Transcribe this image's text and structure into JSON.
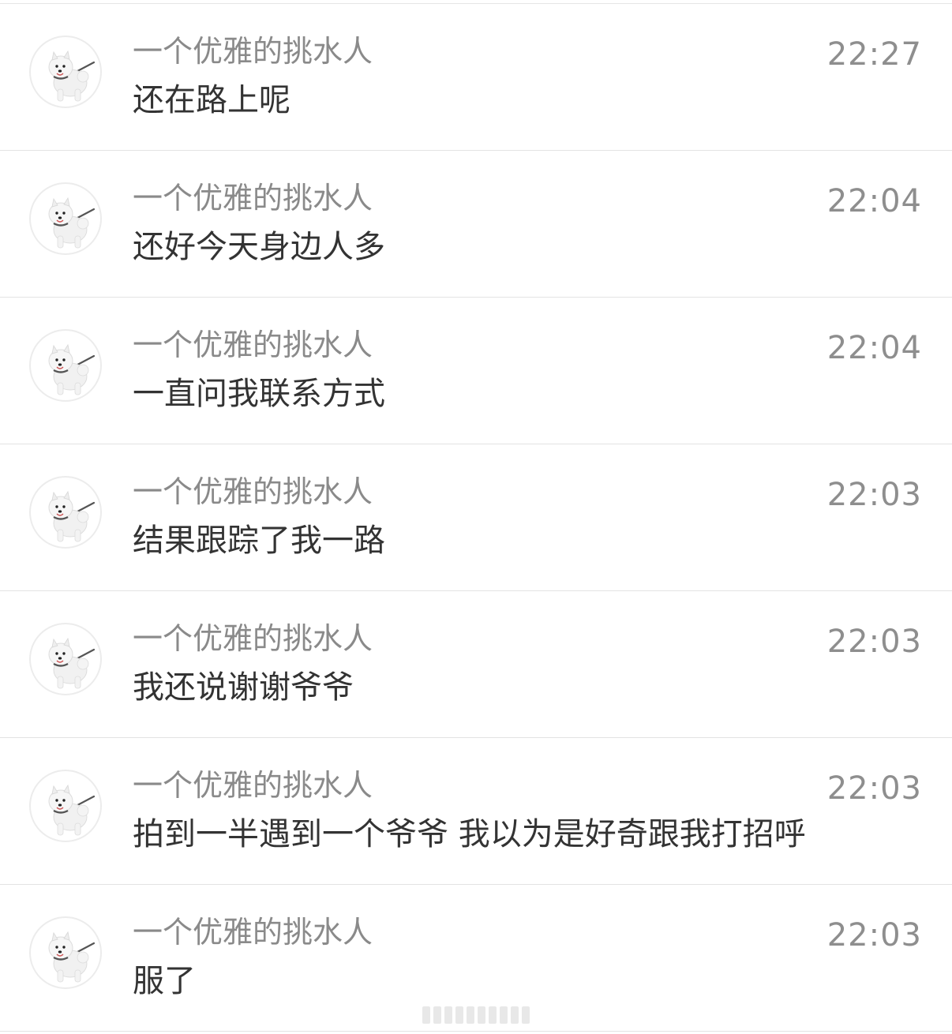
{
  "conversation": {
    "messages": [
      {
        "sender": "一个优雅的挑水人",
        "time": "22:27",
        "text": "还在路上呢"
      },
      {
        "sender": "一个优雅的挑水人",
        "time": "22:04",
        "text": "还好今天身边人多"
      },
      {
        "sender": "一个优雅的挑水人",
        "time": "22:04",
        "text": "一直问我联系方式"
      },
      {
        "sender": "一个优雅的挑水人",
        "time": "22:03",
        "text": "结果跟踪了我一路"
      },
      {
        "sender": "一个优雅的挑水人",
        "time": "22:03",
        "text": "我还说谢谢爷爷"
      },
      {
        "sender": "一个优雅的挑水人",
        "time": "22:03",
        "text": "拍到一半遇到一个爷爷 我以为是好奇跟我打招呼"
      },
      {
        "sender": "一个优雅的挑水人",
        "time": "22:03",
        "text": "服了"
      }
    ]
  },
  "avatar": {
    "icon": "white-dog-avatar-icon"
  },
  "colors": {
    "background": "#ffffff",
    "sender": "#8a8a8a",
    "time": "#8e8e8e",
    "message": "#333333",
    "divider": "#e3e3e3"
  }
}
